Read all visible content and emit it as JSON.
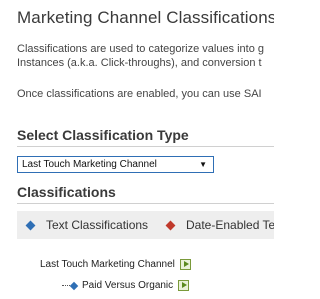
{
  "header": {
    "title": "Marketing Channel Classifications"
  },
  "description": {
    "line1": "Classifications are used to categorize values into g",
    "line2": "Instances (a.k.a. Click-throughs), and conversion t",
    "line3": "Once classifications are enabled, you can use SAI"
  },
  "select_type": {
    "heading": "Select Classification Type",
    "selected_value": "Last Touch Marketing Channel",
    "arrow": "▼"
  },
  "classifications": {
    "heading": "Classifications",
    "tabs": [
      {
        "label": "Text Classifications",
        "icon": "blue-diamond-icon",
        "color": "#2f6fb5"
      },
      {
        "label": "Date-Enabled Tex",
        "icon": "red-diamond-icon",
        "color": "#c0392b"
      }
    ],
    "tree": {
      "root_label": "Last Touch Marketing Channel",
      "children": [
        {
          "label": "Paid Versus Organic"
        }
      ]
    }
  }
}
